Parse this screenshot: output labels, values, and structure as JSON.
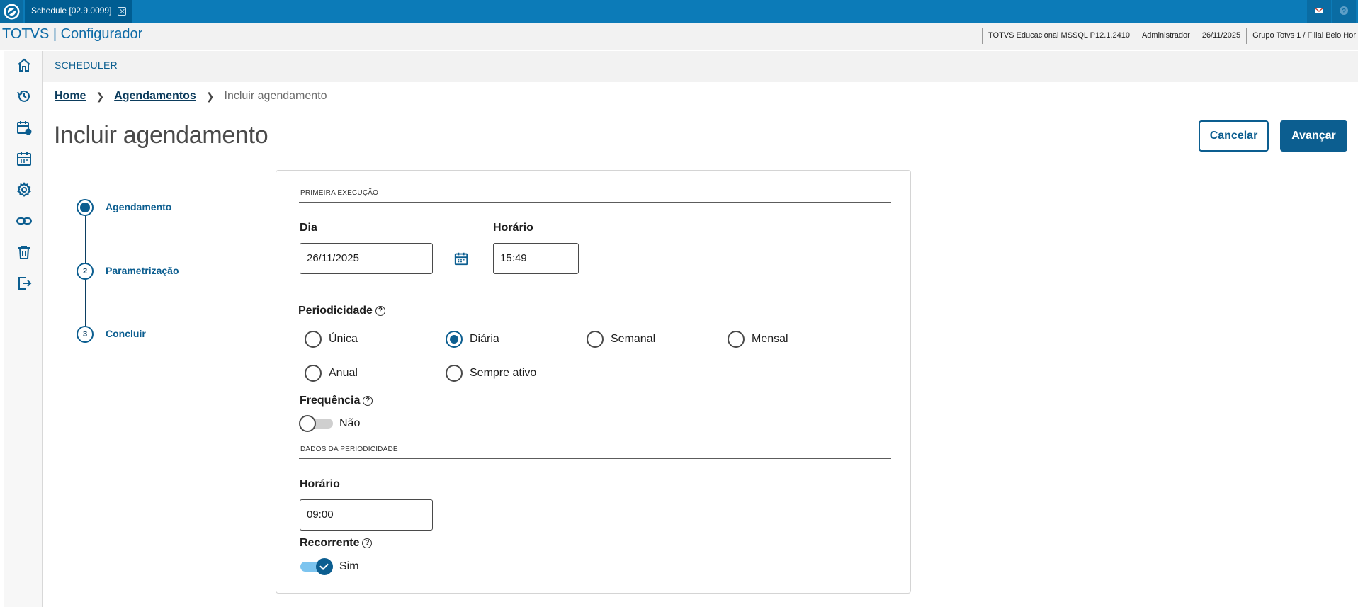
{
  "window": {
    "tab_label": "Schedule [02.9.0099]",
    "app_title": "TOTVS | Configurador",
    "info": [
      "TOTVS Educacional MSSQL P12.1.2410",
      "Administrador",
      "26/11/2025",
      "Grupo Totvs 1 / Filial Belo Hor"
    ]
  },
  "sidebar": {
    "items": [
      "home-icon",
      "history-icon",
      "calendar-settings-icon",
      "calendar-icon",
      "gear-icon",
      "link-icon",
      "trash-icon",
      "logout-icon"
    ]
  },
  "header": {
    "section": "SCHEDULER"
  },
  "breadcrumb": {
    "home": "Home",
    "agendamentos": "Agendamentos",
    "current": "Incluir agendamento"
  },
  "page": {
    "title": "Incluir agendamento"
  },
  "actions": {
    "cancel": "Cancelar",
    "next": "Avançar"
  },
  "steps": [
    {
      "number": "1",
      "label": "Agendamento",
      "active": true
    },
    {
      "number": "2",
      "label": "Parametrização",
      "active": false
    },
    {
      "number": "3",
      "label": "Concluir",
      "active": false
    }
  ],
  "form": {
    "first_execution_title": "PRIMEIRA EXECUÇÃO",
    "day_label": "Dia",
    "day_value": "26/11/2025",
    "time_label": "Horário",
    "time_value": "15:49",
    "periodicity_label": "Periodicidade",
    "periodicity_options": [
      "Única",
      "Diária",
      "Semanal",
      "Mensal",
      "Anual",
      "Sempre ativo"
    ],
    "periodicity_selected": "Diária",
    "frequency_label": "Frequência",
    "frequency_value": "Não",
    "periodicity_data_title": "DADOS DA PERIODICIDADE",
    "period_time_label": "Horário",
    "period_time_value": "09:00",
    "recurring_label": "Recorrente",
    "recurring_value": "Sim"
  },
  "colors": {
    "topbar": "#0c7bb8",
    "primary": "#0c5e90",
    "accent_light": "#7cc4ef"
  }
}
